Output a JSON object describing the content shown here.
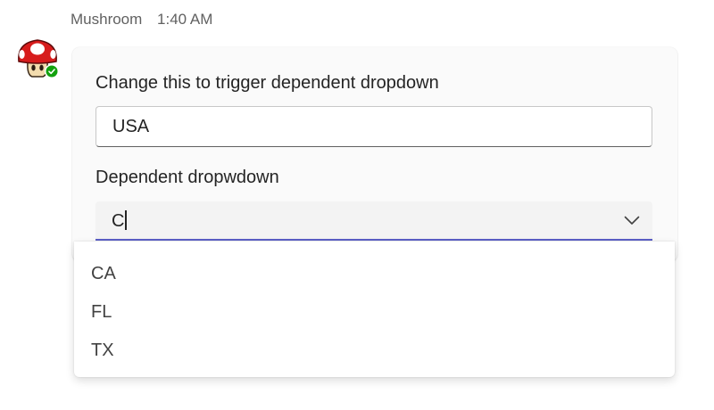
{
  "message": {
    "sender": "Mushroom",
    "time": "1:40 AM",
    "avatar_icon": "mushroom-icon",
    "presence_icon": "available-check-icon",
    "presence_color": "#13a10e"
  },
  "card": {
    "field1": {
      "label": "Change this to trigger dependent dropdown",
      "value": "USA"
    },
    "field2": {
      "label": "Dependent dropwdown",
      "value": "C",
      "chevron_icon": "chevron-down-icon",
      "accent_color": "#5b5fc7"
    }
  },
  "dropdown": {
    "options": [
      "CA",
      "FL",
      "TX"
    ]
  }
}
